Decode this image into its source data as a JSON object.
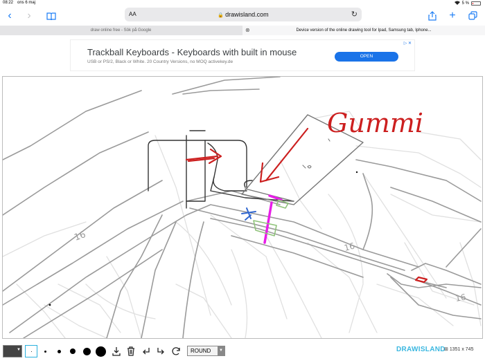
{
  "status": {
    "time": "08:22",
    "date": "ons 6 maj",
    "battery": "5 %"
  },
  "browser": {
    "text_size_label": "AA",
    "url": "drawisland.com",
    "tabs": [
      {
        "label": "draw online free - Sök på Google",
        "active": false
      },
      {
        "label": "Device version of the online drawing tool for Ipad, Samsung tab, Iphone...",
        "active": true
      }
    ]
  },
  "ad": {
    "title": "Trackball Keyboards - Keyboards with built in mouse",
    "subtitle": "USB or PS/2, Black or White. 20 Country Versions, no MOQ activekey.de",
    "button": "OPEN"
  },
  "canvas": {
    "labels": [
      "Gummi",
      "16",
      "16",
      "16"
    ],
    "colors": {
      "pencil": "#9a9a9a",
      "red": "#cc1f1f",
      "magenta": "#e81ee8",
      "blue": "#2f66d0",
      "green": "#8fc27a",
      "black": "#111111"
    }
  },
  "bottombar": {
    "current_color": "#444444",
    "brush_sizes": [
      1,
      2,
      4,
      6,
      8,
      12
    ],
    "selected_brush_index": 0,
    "line_cap": "ROUND",
    "brand": "DRAWISLAND",
    "dimensions": "1351 x 745"
  },
  "icons": [
    "back-icon",
    "forward-icon",
    "bookmarks-icon",
    "lock-icon",
    "reload-icon",
    "share-icon",
    "new-tab-icon",
    "tabs-icon",
    "save-icon",
    "trash-icon",
    "undo-icon",
    "redo-icon",
    "refresh-icon",
    "ad-choices-icon"
  ]
}
